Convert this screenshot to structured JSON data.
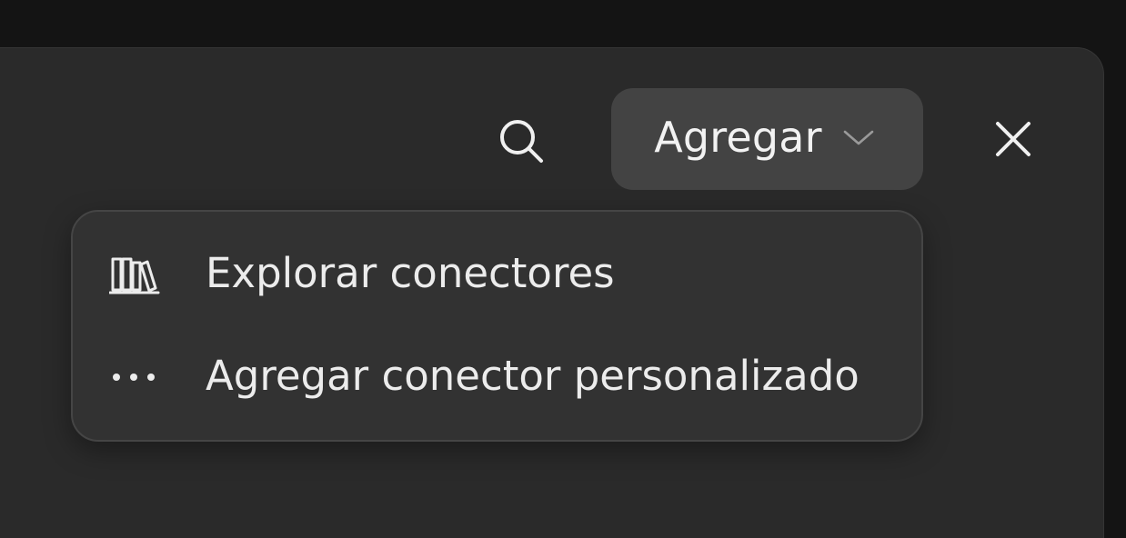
{
  "toolbar": {
    "search_icon": "search-icon",
    "add_button_label": "Agregar",
    "add_button_icon": "chevron-down-icon",
    "close_icon": "close-icon"
  },
  "menu": {
    "items": [
      {
        "label": "Explorar conectores",
        "icon": "library-icon"
      },
      {
        "label": "Agregar conector personalizado",
        "icon": "more-horizontal-icon"
      }
    ]
  },
  "colors": {
    "background": "#141414",
    "panel": "#2a2a2a",
    "button": "#434343",
    "menu": "#323232",
    "text": "#ececec"
  }
}
